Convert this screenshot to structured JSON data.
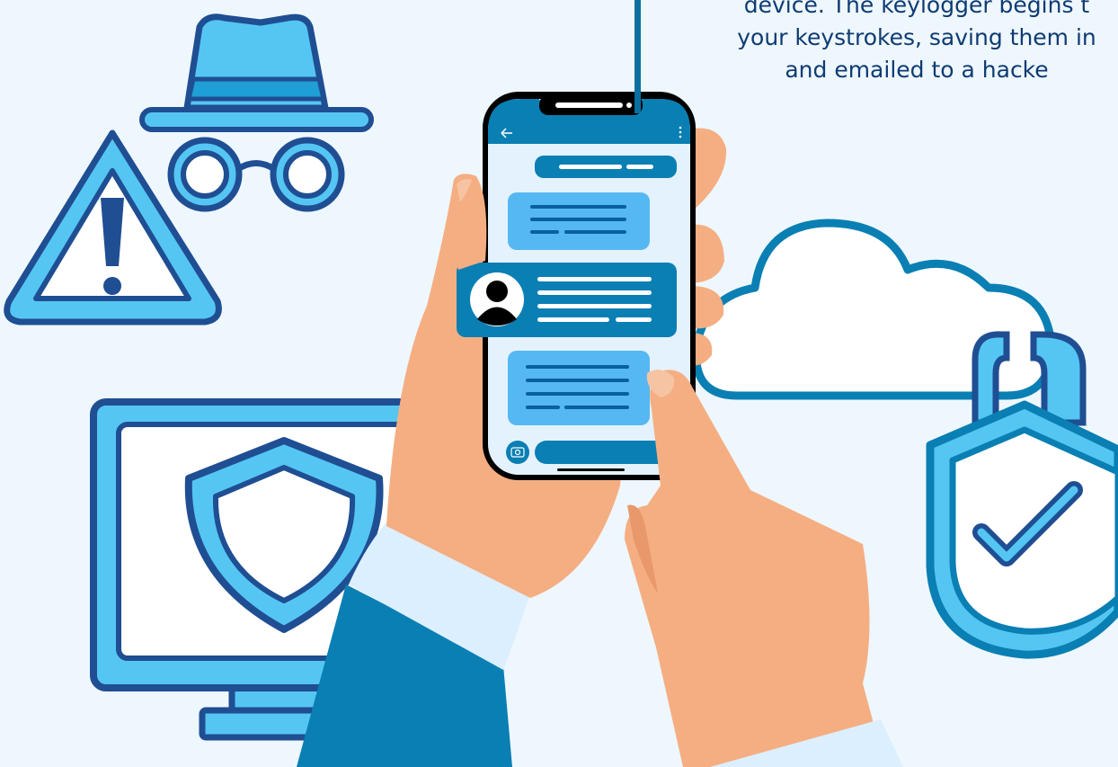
{
  "caption": {
    "line1": "device. The keylogger begins t",
    "line2": "your keystrokes, saving them in",
    "line3": "and emailed to a hacke"
  },
  "phone": {
    "header": {
      "back_icon": "arrow-left-icon",
      "menu_icon": "kebab-menu-icon"
    },
    "messages": [
      "sent-bubble",
      "received-bubble",
      "contact-card",
      "received-bubble"
    ],
    "footer": {
      "camera_icon": "camera-icon"
    }
  },
  "icons": [
    "warning-triangle-icon",
    "spy-icon",
    "monitor-shield-icon",
    "cloud-icon",
    "padlock-check-icon"
  ],
  "colors": {
    "background": "#eef7fd",
    "light_blue": "#55c6f2",
    "dark_blue": "#1f4e93",
    "teal": "#0a7fb3",
    "skin": "#f5ae82"
  }
}
